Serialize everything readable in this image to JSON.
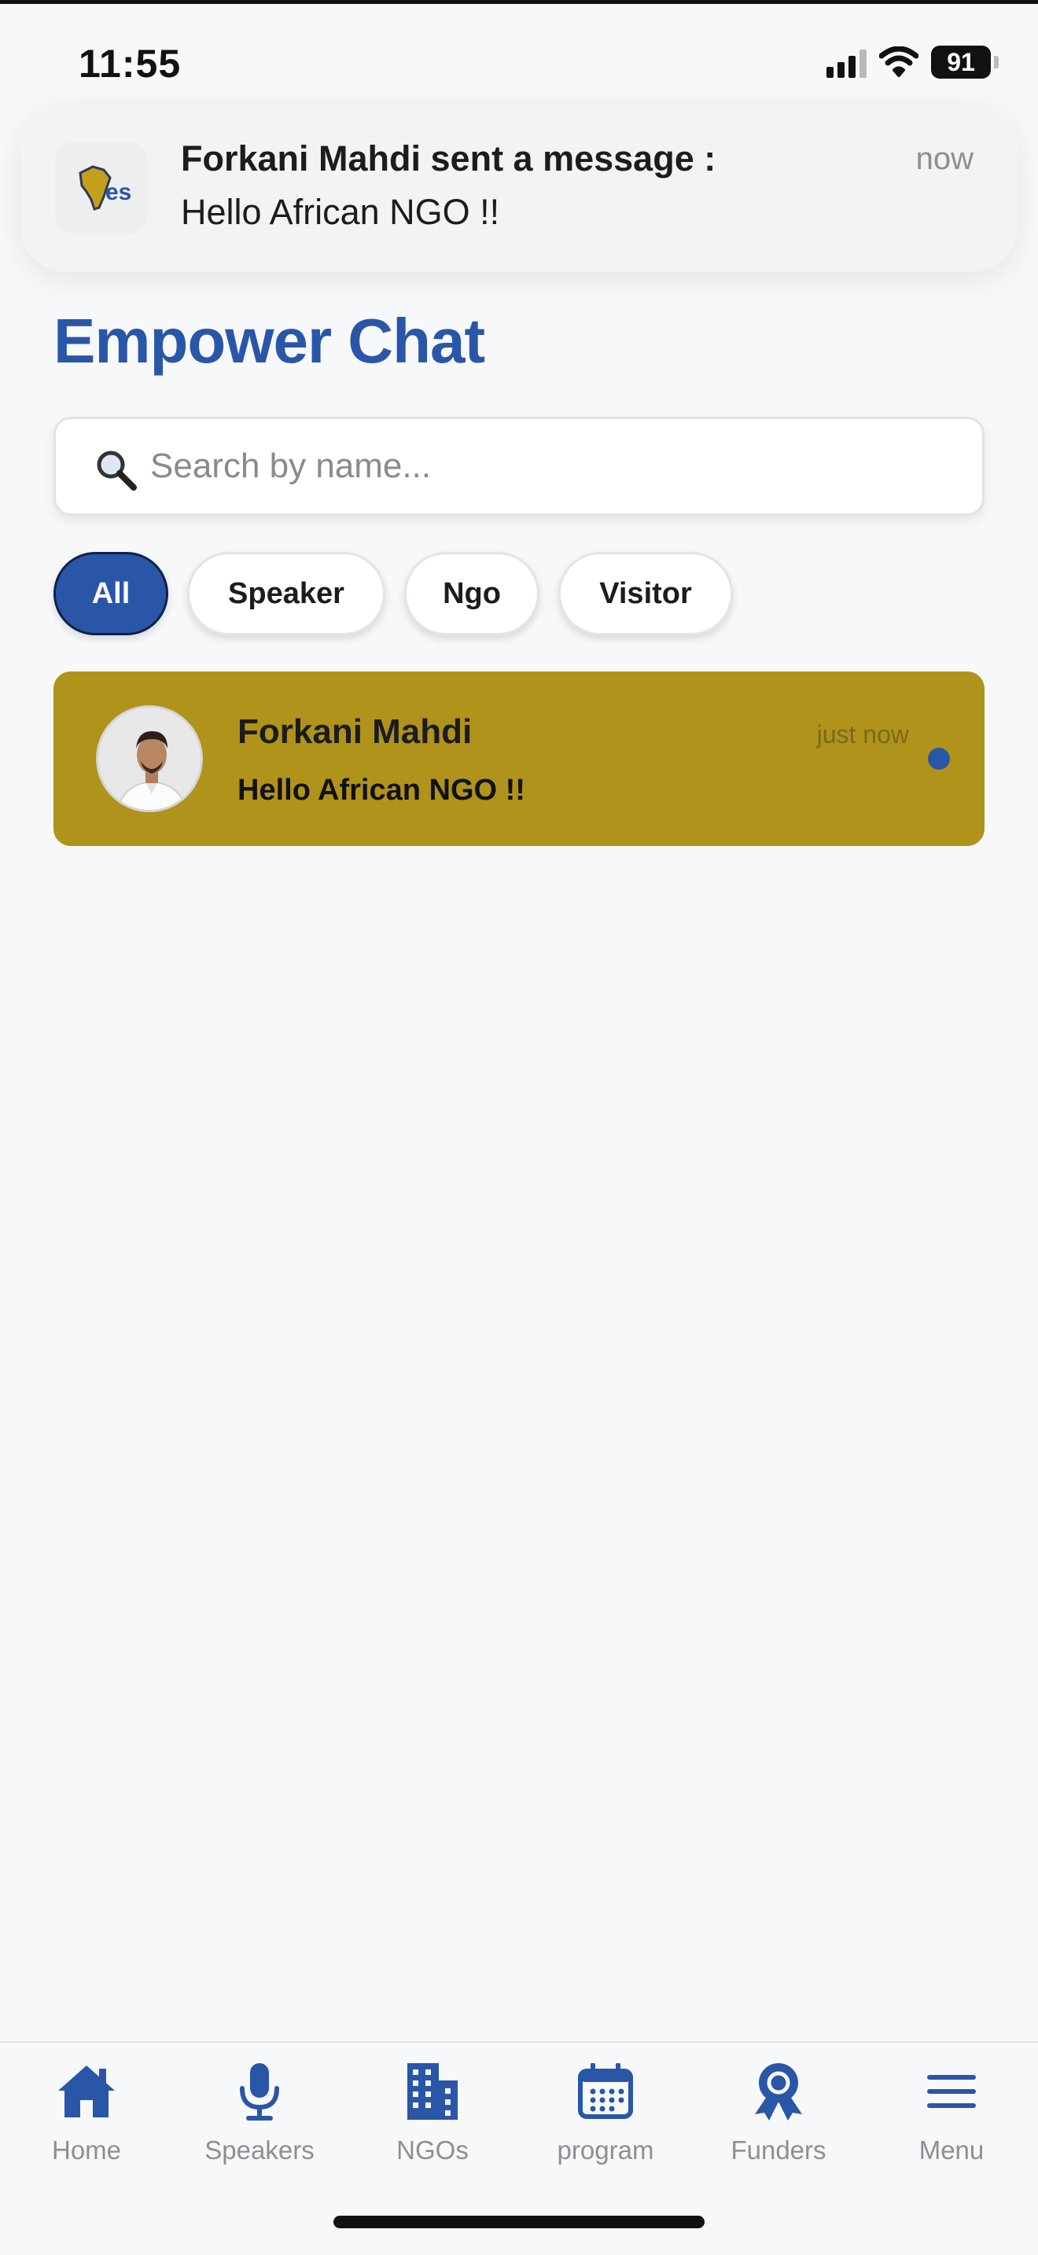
{
  "status_bar": {
    "time": "11:55",
    "battery": "91"
  },
  "notification": {
    "title": "Forkani Mahdi sent a message :",
    "body": "Hello African NGO !!",
    "time": "now",
    "app_icon": "africa-logo-icon"
  },
  "page": {
    "title": "Empower Chat"
  },
  "search": {
    "placeholder": "Search by name...",
    "value": ""
  },
  "filters": [
    {
      "label": "All",
      "active": true
    },
    {
      "label": "Speaker",
      "active": false
    },
    {
      "label": "Ngo",
      "active": false
    },
    {
      "label": "Visitor",
      "active": false
    }
  ],
  "chats": [
    {
      "name": "Forkani Mahdi",
      "message": "Hello African NGO !!",
      "time": "just now",
      "unread": true
    }
  ],
  "nav": [
    {
      "label": "Home",
      "icon": "home-icon"
    },
    {
      "label": "Speakers",
      "icon": "microphone-icon"
    },
    {
      "label": "NGOs",
      "icon": "building-icon"
    },
    {
      "label": "program",
      "icon": "calendar-icon"
    },
    {
      "label": "Funders",
      "icon": "award-icon"
    },
    {
      "label": "Menu",
      "icon": "menu-icon"
    }
  ],
  "colors": {
    "primary": "#2a56a8",
    "chat_highlight": "#af931a",
    "background": "#f7f8fa"
  }
}
